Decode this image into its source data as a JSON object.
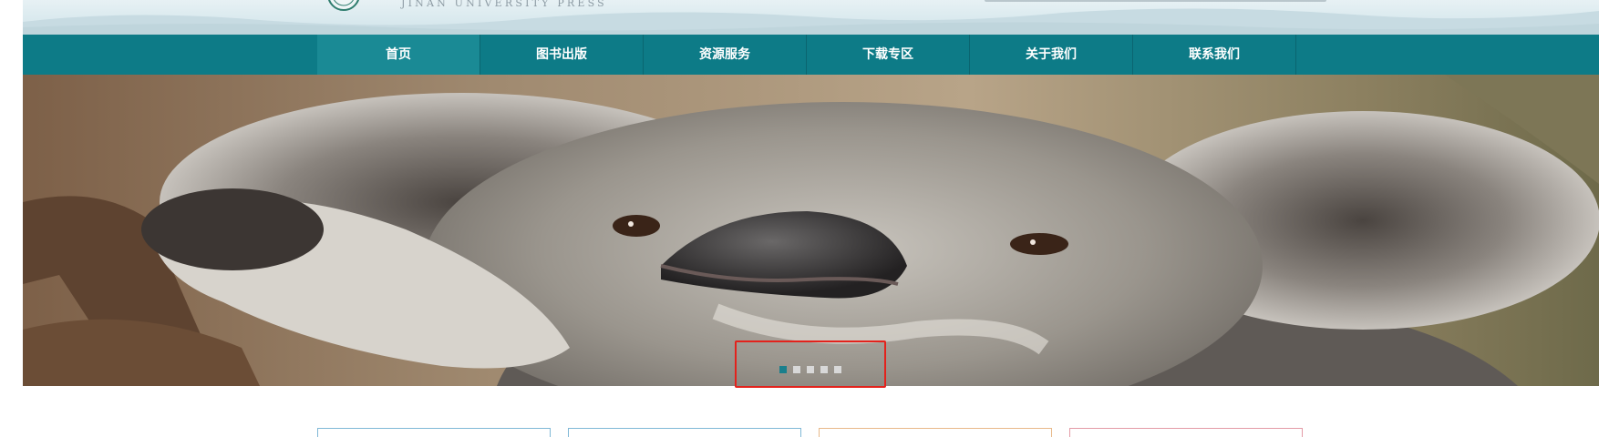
{
  "header": {
    "logo_text": "JINAN UNIVERSITY PRESS"
  },
  "nav": {
    "items": [
      {
        "label": "首页",
        "active": true
      },
      {
        "label": "图书出版",
        "active": false
      },
      {
        "label": "资源服务",
        "active": false
      },
      {
        "label": "下载专区",
        "active": false
      },
      {
        "label": "关于我们",
        "active": false
      },
      {
        "label": "联系我们",
        "active": false
      }
    ]
  },
  "banner": {
    "slide_count": 5,
    "active_slide": 1
  },
  "colors": {
    "nav_bg": "#0d7b87",
    "active_dot": "#1a7f8c",
    "highlight": "#e3221c"
  }
}
